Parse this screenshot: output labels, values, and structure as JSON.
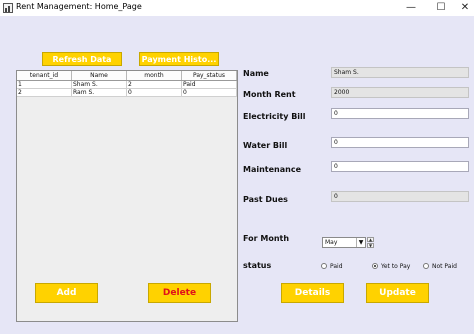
{
  "window": {
    "title": "Rent Management: Home_Page",
    "min": "—",
    "max": "☐",
    "close": "✕"
  },
  "top_buttons": {
    "refresh": "Refresh Data",
    "payment_history": "Payment Histo..."
  },
  "table": {
    "columns": [
      "tenant_id",
      "Name",
      "month",
      "Pay_status"
    ],
    "rows": [
      [
        "1",
        "Sham S.",
        "2",
        "Paid"
      ],
      [
        "2",
        "Ram S.",
        "0",
        "0"
      ]
    ]
  },
  "form": {
    "name_label": "Name",
    "name_value": "Sham S.",
    "month_rent_label": "Month Rent",
    "month_rent_value": "2000",
    "electricity_label": "Electricity Bill",
    "electricity_value": "0",
    "water_label": "Water Bill",
    "water_value": "0",
    "maintenance_label": "Maintenance",
    "maintenance_value": "0",
    "past_dues_label": "Past Dues",
    "past_dues_value": "0",
    "for_month_label": "For Month",
    "for_month_value": "May",
    "status_label": "status",
    "status_options": [
      {
        "label": "Paid",
        "selected": false
      },
      {
        "label": "Yet to Pay",
        "selected": true
      },
      {
        "label": "Not Paid",
        "selected": false
      }
    ]
  },
  "bottom_buttons": {
    "add": "Add",
    "delete": "Delete",
    "details": "Details",
    "update": "Update"
  },
  "colors": {
    "background": "#e6e6f6",
    "button_yellow": "#ffd200",
    "delete_text": "#e0101a"
  }
}
